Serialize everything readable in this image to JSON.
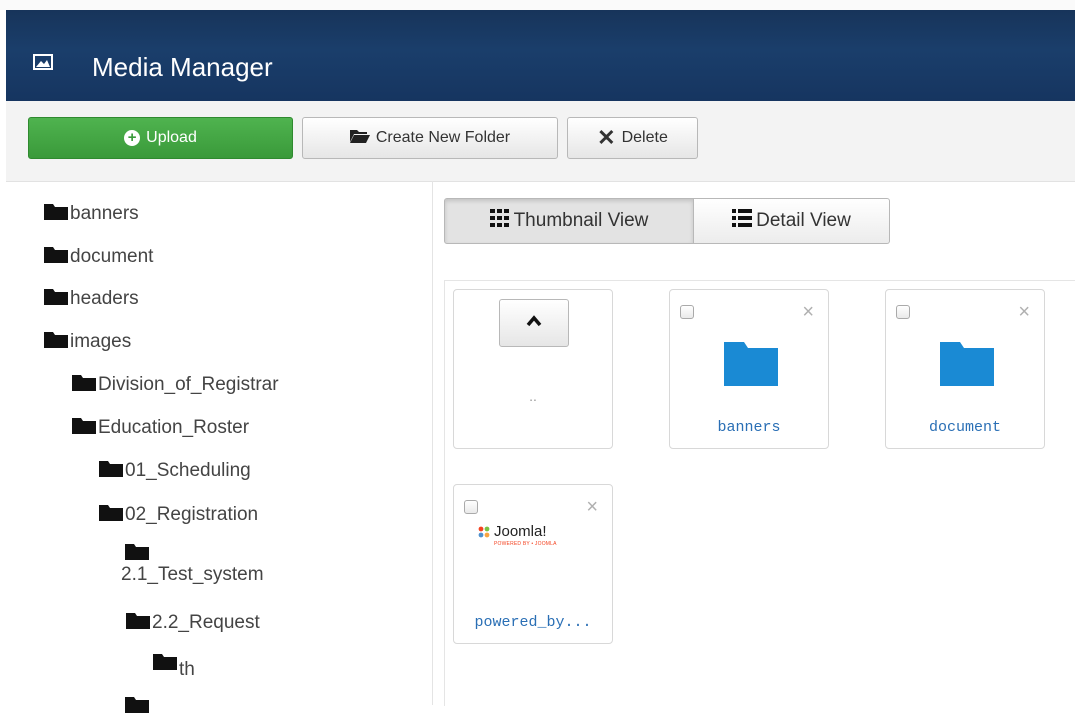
{
  "header": {
    "title": "Media Manager",
    "icon": "image-icon"
  },
  "toolbar": {
    "upload_label": "Upload",
    "create_folder_label": "Create New Folder",
    "delete_label": "Delete"
  },
  "tree": {
    "items": [
      {
        "label": "banners"
      },
      {
        "label": "document"
      },
      {
        "label": "headers"
      },
      {
        "label": "images"
      },
      {
        "label": "Division_of_Registrar"
      },
      {
        "label": "Education_Roster"
      },
      {
        "label": "01_Scheduling"
      },
      {
        "label": "02_Registration"
      },
      {
        "label": "2.1_Test_system"
      },
      {
        "label": "2.2_Request"
      },
      {
        "label": "th"
      }
    ]
  },
  "views": {
    "thumbnail_label": "Thumbnail View",
    "detail_label": "Detail View",
    "active": "thumbnail"
  },
  "thumbs": {
    "up_label": "..",
    "items": [
      {
        "name": "banners",
        "type": "folder"
      },
      {
        "name": "document",
        "type": "folder"
      },
      {
        "name": "powered_by...",
        "type": "image",
        "logo_text": "Joomla!",
        "logo_subtext": "POWERED BY • JOOMLA"
      }
    ]
  },
  "colors": {
    "header": "#1a3e6b",
    "upload": "#46a846",
    "folder": "#1a8ad4",
    "link": "#2a6fb5"
  }
}
